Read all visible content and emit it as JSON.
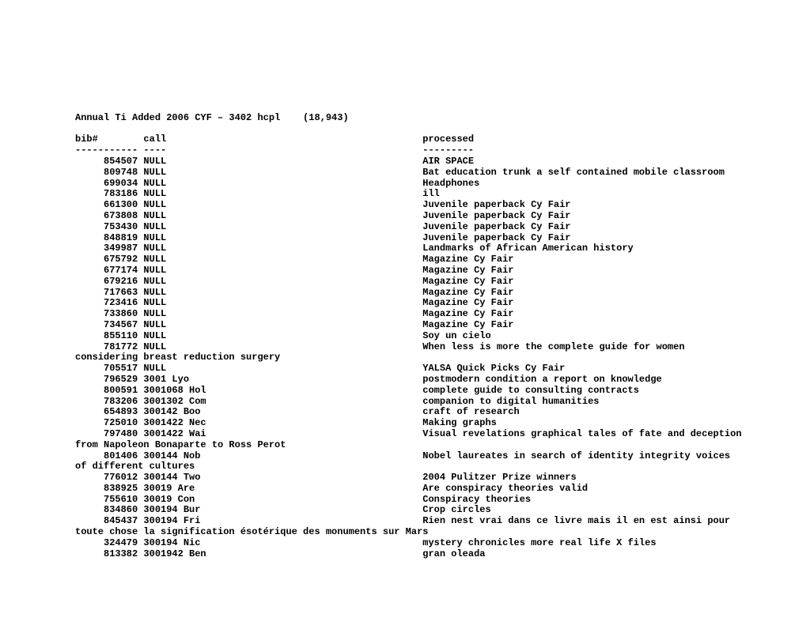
{
  "title": "Annual Ti Added 2006 CYF – 3402 hcpl    (18,943)",
  "header": {
    "bib": "bib#",
    "call": "call",
    "processed": "processed"
  },
  "sep": {
    "bib": "-----------",
    "call": "----",
    "processed": "---------"
  },
  "rows": [
    {
      "bib": "854507",
      "call": "NULL",
      "processed": "AIR SPACE"
    },
    {
      "bib": "809748",
      "call": "NULL",
      "processed": "Bat education trunk a self contained mobile classroom"
    },
    {
      "bib": "699034",
      "call": "NULL",
      "processed": "Headphones"
    },
    {
      "bib": "783186",
      "call": "NULL",
      "processed": "ill"
    },
    {
      "bib": "661300",
      "call": "NULL",
      "processed": "Juvenile paperback Cy Fair"
    },
    {
      "bib": "673808",
      "call": "NULL",
      "processed": "Juvenile paperback Cy Fair"
    },
    {
      "bib": "753430",
      "call": "NULL",
      "processed": "Juvenile paperback Cy Fair"
    },
    {
      "bib": "848819",
      "call": "NULL",
      "processed": "Juvenile paperback Cy Fair"
    },
    {
      "bib": "349987",
      "call": "NULL",
      "processed": "Landmarks of African American history"
    },
    {
      "bib": "675792",
      "call": "NULL",
      "processed": "Magazine Cy Fair"
    },
    {
      "bib": "677174",
      "call": "NULL",
      "processed": "Magazine Cy Fair"
    },
    {
      "bib": "679216",
      "call": "NULL",
      "processed": "Magazine Cy Fair"
    },
    {
      "bib": "717663",
      "call": "NULL",
      "processed": "Magazine Cy Fair"
    },
    {
      "bib": "723416",
      "call": "NULL",
      "processed": "Magazine Cy Fair"
    },
    {
      "bib": "733860",
      "call": "NULL",
      "processed": "Magazine Cy Fair"
    },
    {
      "bib": "734567",
      "call": "NULL",
      "processed": "Magazine Cy Fair"
    },
    {
      "bib": "855110",
      "call": "NULL",
      "processed": "Soy un cielo"
    },
    {
      "bib": "781772",
      "call": "NULL",
      "processed": "When less is more the complete guide for women",
      "wrap": "considering breast reduction surgery"
    },
    {
      "bib": "705517",
      "call": "NULL",
      "processed": "YALSA Quick Picks Cy Fair"
    },
    {
      "bib": "796529",
      "call": "3001 Lyo",
      "processed": "postmodern condition a report on knowledge"
    },
    {
      "bib": "800591",
      "call": "3001068 Hol",
      "processed": "complete guide to consulting contracts"
    },
    {
      "bib": "783206",
      "call": "3001302 Com",
      "processed": "companion to digital humanities"
    },
    {
      "bib": "654893",
      "call": "300142 Boo",
      "processed": "craft of research"
    },
    {
      "bib": "725010",
      "call": "3001422 Nec",
      "processed": "Making graphs"
    },
    {
      "bib": "797480",
      "call": "3001422 Wai",
      "processed": "Visual revelations graphical tales of fate and deception",
      "wrap": "from Napoleon Bonaparte to Ross Perot"
    },
    {
      "bib": "801406",
      "call": "300144 Nob",
      "processed": "Nobel laureates in search of identity integrity voices",
      "wrap": "of different cultures"
    },
    {
      "bib": "776012",
      "call": "300144 Two",
      "processed": "2004 Pulitzer Prize winners"
    },
    {
      "bib": "838925",
      "call": "30019 Are",
      "processed": "Are conspiracy theories valid"
    },
    {
      "bib": "755610",
      "call": "30019 Con",
      "processed": "Conspiracy theories"
    },
    {
      "bib": "834860",
      "call": "300194 Bur",
      "processed": "Crop circles"
    },
    {
      "bib": "845437",
      "call": "300194 Fri",
      "processed": "Rien nest vrai dans ce livre mais il en est ainsi pour",
      "wrap": "toute chose la signification ésotérique des monuments sur Mars"
    },
    {
      "bib": "324479",
      "call": "300194 Nic",
      "processed": "mystery chronicles more real life X files"
    },
    {
      "bib": "813382",
      "call": "3001942 Ben",
      "processed": "gran oleada"
    }
  ]
}
